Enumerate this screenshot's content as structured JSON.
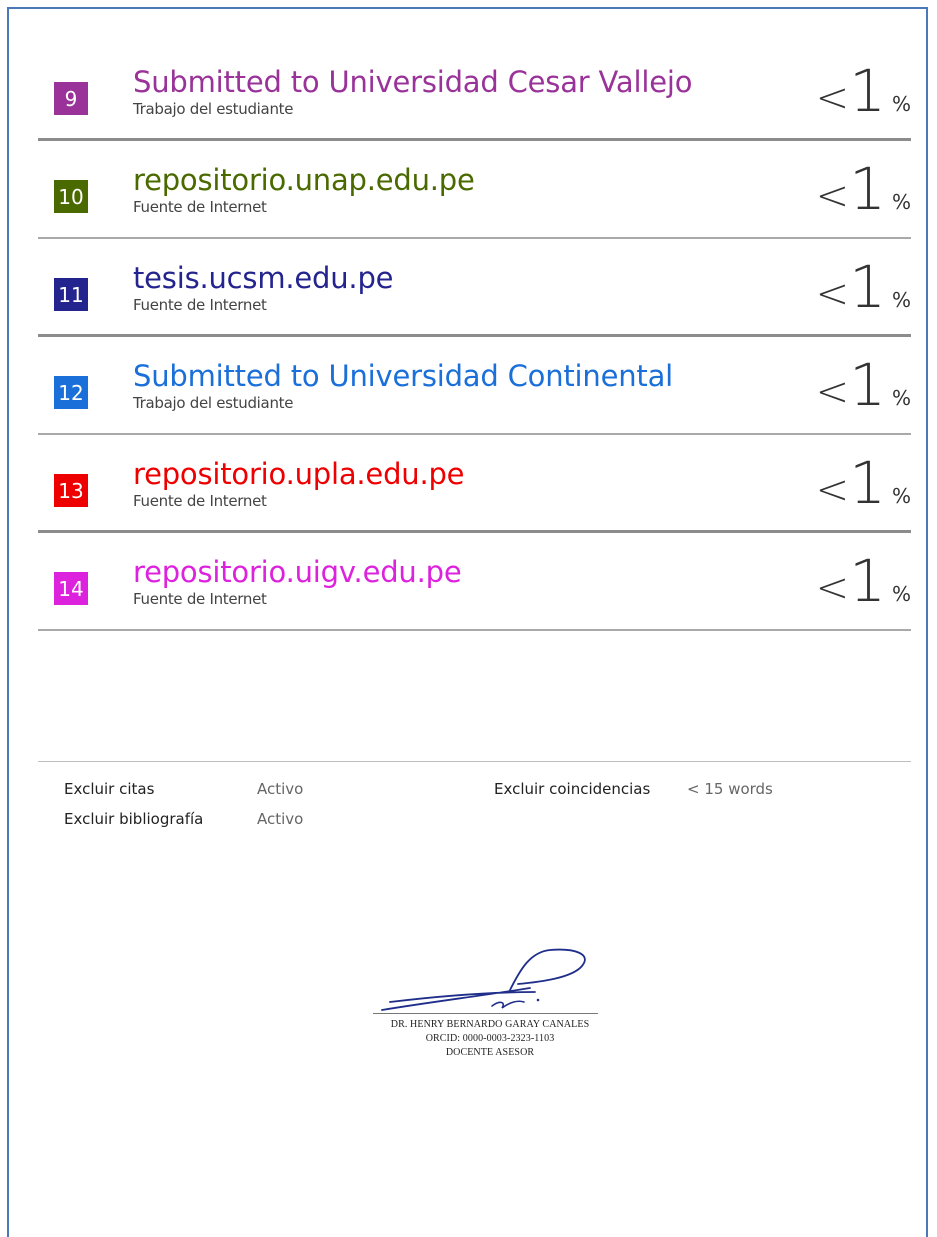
{
  "sources": [
    {
      "number": "9",
      "title": "Submitted to Universidad Cesar Vallejo",
      "type": "Trabajo del estudiante",
      "percent_prefix": "<",
      "percent_value": "1",
      "percent_symbol": "%",
      "color": "#993399"
    },
    {
      "number": "10",
      "title": "repositorio.unap.edu.pe",
      "type": "Fuente de Internet",
      "percent_prefix": "<",
      "percent_value": "1",
      "percent_symbol": "%",
      "color": "#4a6a00"
    },
    {
      "number": "11",
      "title": "tesis.ucsm.edu.pe",
      "type": "Fuente de Internet",
      "percent_prefix": "<",
      "percent_value": "1",
      "percent_symbol": "%",
      "color": "#24248f"
    },
    {
      "number": "12",
      "title": "Submitted to Universidad Continental",
      "type": "Trabajo del estudiante",
      "percent_prefix": "<",
      "percent_value": "1",
      "percent_symbol": "%",
      "color": "#1a6fd9"
    },
    {
      "number": "13",
      "title": "repositorio.upla.edu.pe",
      "type": "Fuente de Internet",
      "percent_prefix": "<",
      "percent_value": "1",
      "percent_symbol": "%",
      "color": "#ee0000"
    },
    {
      "number": "14",
      "title": "repositorio.uigv.edu.pe",
      "type": "Fuente de Internet",
      "percent_prefix": "<",
      "percent_value": "1",
      "percent_symbol": "%",
      "color": "#dd22dd"
    }
  ],
  "settings": {
    "exclude_quotes_label": "Excluir citas",
    "exclude_quotes_value": "Activo",
    "exclude_bibliography_label": "Excluir bibliografía",
    "exclude_bibliography_value": "Activo",
    "exclude_matches_label": "Excluir coincidencias",
    "exclude_matches_value": "< 15 words"
  },
  "signature": {
    "name": "DR. HENRY BERNARDO GARAY CANALES",
    "orcid": "ORCID: 0000-0003-2323-1103",
    "role": "DOCENTE ASESOR"
  }
}
